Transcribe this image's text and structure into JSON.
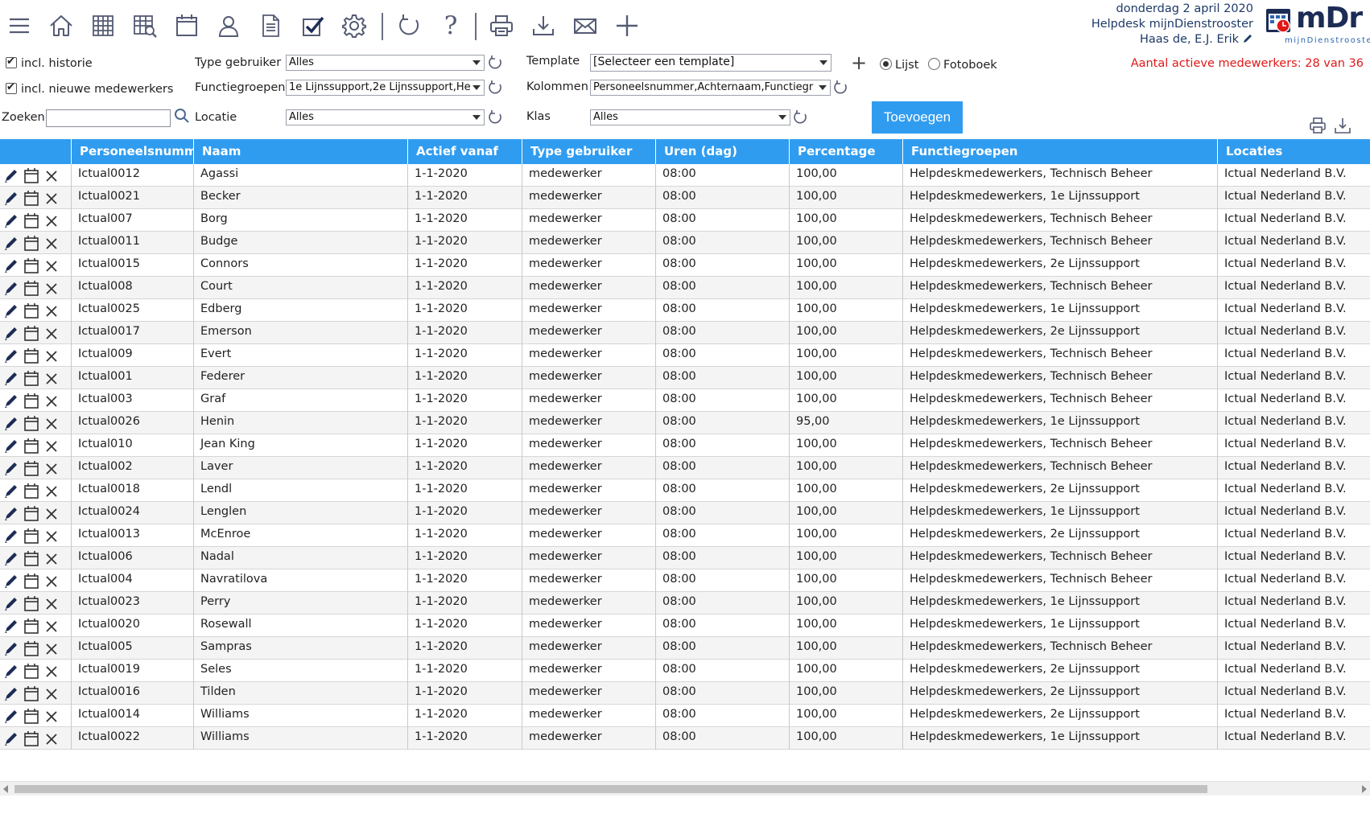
{
  "toolbar": {
    "icons": [
      "menu-icon",
      "home-icon",
      "grid-icon",
      "search-grid-icon",
      "calendar-icon",
      "user-icon",
      "document-icon",
      "checkbox-icon",
      "gear-icon",
      "refresh-icon",
      "help-icon",
      "print-icon",
      "download-icon",
      "mail-icon",
      "plus-icon"
    ],
    "help_glyph": "?"
  },
  "header": {
    "date": "donderdag 2 april 2020",
    "org": "Helpdesk mijnDienstrooster",
    "user": "Haas de, E.J. Erik",
    "logo_text": "mDr",
    "logo_sub": "mijnDienstrooster",
    "active_count": "Aantal actieve medewerkers: 28 van 36"
  },
  "filters": {
    "incl_historie": {
      "label": "incl. historie",
      "checked": true
    },
    "incl_nieuwe": {
      "label": "incl. nieuwe medewerkers",
      "checked": true
    },
    "zoeken_label": "Zoeken",
    "zoeken_value": "",
    "type_gebruiker": {
      "label": "Type gebruiker",
      "value": "Alles"
    },
    "functiegroepen": {
      "label": "Functiegroepen",
      "value": "1e Lijnssupport,2e Lijnssupport,He"
    },
    "locatie": {
      "label": "Locatie",
      "value": "Alles"
    },
    "template": {
      "label": "Template",
      "value": "[Selecteer een template]"
    },
    "kolommen": {
      "label": "Kolommen",
      "value": "Personeelsnummer,Achternaam,Functiegr"
    },
    "klas": {
      "label": "Klas",
      "value": "Alles"
    },
    "view_lijst": "Lijst",
    "view_fotoboek": "Fotoboek",
    "selected_view": "Lijst",
    "add_button": "Toevoegen"
  },
  "table": {
    "columns": [
      "Personeelsnummer",
      "Naam",
      "Actief vanaf",
      "Type gebruiker",
      "Uren (dag)",
      "Percentage",
      "Functiegroepen",
      "Locaties"
    ],
    "rows": [
      [
        "Ictual0012",
        "Agassi",
        "1-1-2020",
        "medewerker",
        "08:00",
        "100,00",
        "Helpdeskmedewerkers, Technisch Beheer",
        "Ictual Nederland B.V."
      ],
      [
        "Ictual0021",
        "Becker",
        "1-1-2020",
        "medewerker",
        "08:00",
        "100,00",
        "Helpdeskmedewerkers, 1e Lijnssupport",
        "Ictual Nederland B.V."
      ],
      [
        "Ictual007",
        "Borg",
        "1-1-2020",
        "medewerker",
        "08:00",
        "100,00",
        "Helpdeskmedewerkers, Technisch Beheer",
        "Ictual Nederland B.V."
      ],
      [
        "Ictual0011",
        "Budge",
        "1-1-2020",
        "medewerker",
        "08:00",
        "100,00",
        "Helpdeskmedewerkers, Technisch Beheer",
        "Ictual Nederland B.V."
      ],
      [
        "Ictual0015",
        "Connors",
        "1-1-2020",
        "medewerker",
        "08:00",
        "100,00",
        "Helpdeskmedewerkers, 2e Lijnssupport",
        "Ictual Nederland B.V."
      ],
      [
        "Ictual008",
        "Court",
        "1-1-2020",
        "medewerker",
        "08:00",
        "100,00",
        "Helpdeskmedewerkers, Technisch Beheer",
        "Ictual Nederland B.V."
      ],
      [
        "Ictual0025",
        "Edberg",
        "1-1-2020",
        "medewerker",
        "08:00",
        "100,00",
        "Helpdeskmedewerkers, 1e Lijnssupport",
        "Ictual Nederland B.V."
      ],
      [
        "Ictual0017",
        "Emerson",
        "1-1-2020",
        "medewerker",
        "08:00",
        "100,00",
        "Helpdeskmedewerkers, 2e Lijnssupport",
        "Ictual Nederland B.V."
      ],
      [
        "Ictual009",
        "Evert",
        "1-1-2020",
        "medewerker",
        "08:00",
        "100,00",
        "Helpdeskmedewerkers, Technisch Beheer",
        "Ictual Nederland B.V."
      ],
      [
        "Ictual001",
        "Federer",
        "1-1-2020",
        "medewerker",
        "08:00",
        "100,00",
        "Helpdeskmedewerkers, Technisch Beheer",
        "Ictual Nederland B.V."
      ],
      [
        "Ictual003",
        "Graf",
        "1-1-2020",
        "medewerker",
        "08:00",
        "100,00",
        "Helpdeskmedewerkers, Technisch Beheer",
        "Ictual Nederland B.V."
      ],
      [
        "Ictual0026",
        "Henin",
        "1-1-2020",
        "medewerker",
        "08:00",
        "95,00",
        "Helpdeskmedewerkers, 1e Lijnssupport",
        "Ictual Nederland B.V."
      ],
      [
        "Ictual010",
        "Jean King",
        "1-1-2020",
        "medewerker",
        "08:00",
        "100,00",
        "Helpdeskmedewerkers, Technisch Beheer",
        "Ictual Nederland B.V."
      ],
      [
        "Ictual002",
        "Laver",
        "1-1-2020",
        "medewerker",
        "08:00",
        "100,00",
        "Helpdeskmedewerkers, Technisch Beheer",
        "Ictual Nederland B.V."
      ],
      [
        "Ictual0018",
        "Lendl",
        "1-1-2020",
        "medewerker",
        "08:00",
        "100,00",
        "Helpdeskmedewerkers, 2e Lijnssupport",
        "Ictual Nederland B.V."
      ],
      [
        "Ictual0024",
        "Lenglen",
        "1-1-2020",
        "medewerker",
        "08:00",
        "100,00",
        "Helpdeskmedewerkers, 1e Lijnssupport",
        "Ictual Nederland B.V."
      ],
      [
        "Ictual0013",
        "McEnroe",
        "1-1-2020",
        "medewerker",
        "08:00",
        "100,00",
        "Helpdeskmedewerkers, 2e Lijnssupport",
        "Ictual Nederland B.V."
      ],
      [
        "Ictual006",
        "Nadal",
        "1-1-2020",
        "medewerker",
        "08:00",
        "100,00",
        "Helpdeskmedewerkers, Technisch Beheer",
        "Ictual Nederland B.V."
      ],
      [
        "Ictual004",
        "Navratilova",
        "1-1-2020",
        "medewerker",
        "08:00",
        "100,00",
        "Helpdeskmedewerkers, Technisch Beheer",
        "Ictual Nederland B.V."
      ],
      [
        "Ictual0023",
        "Perry",
        "1-1-2020",
        "medewerker",
        "08:00",
        "100,00",
        "Helpdeskmedewerkers, 1e Lijnssupport",
        "Ictual Nederland B.V."
      ],
      [
        "Ictual0020",
        "Rosewall",
        "1-1-2020",
        "medewerker",
        "08:00",
        "100,00",
        "Helpdeskmedewerkers, 1e Lijnssupport",
        "Ictual Nederland B.V."
      ],
      [
        "Ictual005",
        "Sampras",
        "1-1-2020",
        "medewerker",
        "08:00",
        "100,00",
        "Helpdeskmedewerkers, Technisch Beheer",
        "Ictual Nederland B.V."
      ],
      [
        "Ictual0019",
        "Seles",
        "1-1-2020",
        "medewerker",
        "08:00",
        "100,00",
        "Helpdeskmedewerkers, 2e Lijnssupport",
        "Ictual Nederland B.V."
      ],
      [
        "Ictual0016",
        "Tilden",
        "1-1-2020",
        "medewerker",
        "08:00",
        "100,00",
        "Helpdeskmedewerkers, 2e Lijnssupport",
        "Ictual Nederland B.V."
      ],
      [
        "Ictual0014",
        "Williams",
        "1-1-2020",
        "medewerker",
        "08:00",
        "100,00",
        "Helpdeskmedewerkers, 2e Lijnssupport",
        "Ictual Nederland B.V."
      ],
      [
        "Ictual0022",
        "Williams",
        "1-1-2020",
        "medewerker",
        "08:00",
        "100,00",
        "Helpdeskmedewerkers, 1e Lijnssupport",
        "Ictual Nederland B.V."
      ]
    ],
    "row_actions": [
      "edit-pencil-icon",
      "calendar-icon",
      "delete-x-icon"
    ]
  },
  "colors": {
    "accent": "#2f9cf0",
    "header_text": "#1e3a68",
    "alert": "#e01818",
    "icon_gray": "#555b74",
    "row_alt": "#f4f4f4"
  }
}
